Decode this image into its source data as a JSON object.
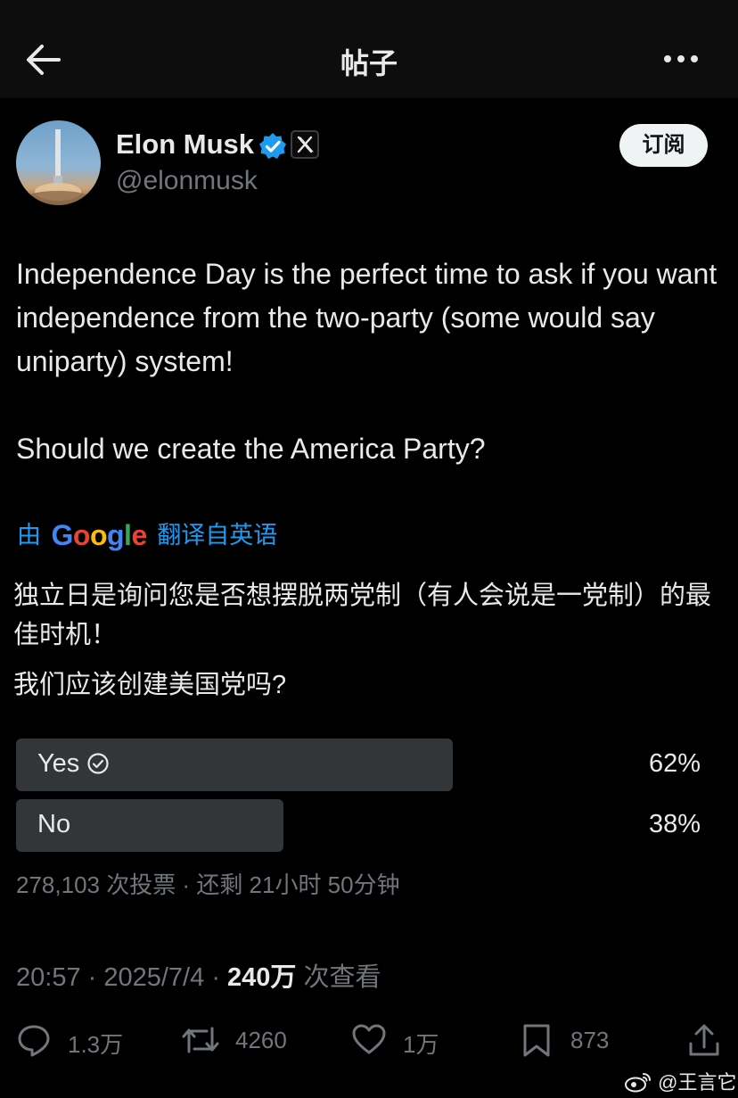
{
  "header": {
    "title": "帖子"
  },
  "author": {
    "name": "Elon Musk",
    "handle": "@elonmusk",
    "subscribe_label": "订阅",
    "verified_color": "#1d9bf0"
  },
  "tweet": {
    "paragraph1": "Independence Day is the perfect time to ask if you want independence from the two-party (some would say uniparty) system!",
    "paragraph2": "Should we create the America Party?"
  },
  "translation": {
    "prefix": "由",
    "provider": "Google",
    "suffix": "翻译自英语",
    "paragraph1": "独立日是询问您是否想摆脱两党制（有人会说是一党制）的最佳时机！",
    "paragraph2": "我们应该创建美国党吗?"
  },
  "poll": {
    "options": [
      {
        "label": "Yes",
        "percent_label": "62%",
        "percent": 62,
        "winner": true
      },
      {
        "label": "No",
        "percent_label": "38%",
        "percent": 38,
        "winner": false
      }
    ],
    "bar_colors": {
      "winner": "#333639",
      "other": "#333639"
    },
    "meta": "278,103 次投票 · 还剩 21小时 50分钟"
  },
  "post_meta": {
    "time": "20:57",
    "date": "2025/7/4",
    "views": "240万",
    "views_suffix": "次查看"
  },
  "actions": {
    "replies": "1.3万",
    "reposts": "4260",
    "likes": "1万",
    "bookmarks": "873"
  },
  "watermark": "@王言它"
}
